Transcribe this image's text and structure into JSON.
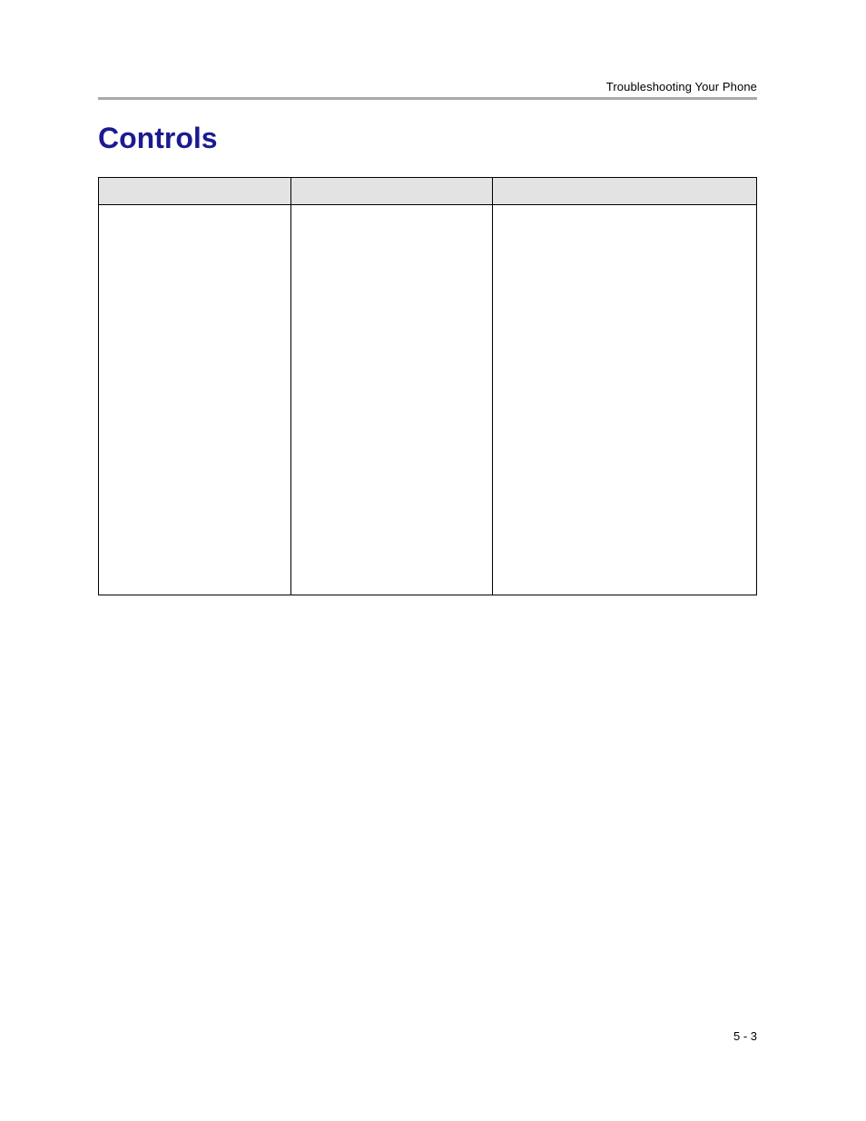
{
  "running_header": "Troubleshooting Your Phone",
  "section_title": "Controls",
  "table": {
    "headers": [
      "",
      "",
      ""
    ],
    "rows": [
      {
        "c1": "",
        "c2": "",
        "c3": ""
      }
    ]
  },
  "page_number": "5 - 3"
}
